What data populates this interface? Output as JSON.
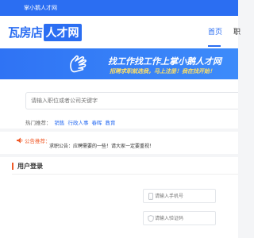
{
  "topbar": {
    "welcome": "掌小鹅人才网"
  },
  "header": {
    "logo_main": "瓦房店",
    "logo_box": "人才网",
    "nav": [
      {
        "label": "首页",
        "active": true
      },
      {
        "label": "职"
      }
    ]
  },
  "banner": {
    "headline": "找工作找工作上掌小鹅人才网",
    "subline": "招聘求职就选我，马上注册！我在找开始！"
  },
  "search": {
    "placeholder": "请输入职位或者公司关键字",
    "hot_label": "热门推荐：",
    "hot_links": [
      "销售",
      "行政人事",
      "春晖",
      "教育"
    ]
  },
  "notice": {
    "title": "公告推荐：",
    "text": "求职公告：应聘需要的一些！请大家一定要重视！"
  },
  "login": {
    "title": "用户登录",
    "phone_placeholder": "请输入手机号",
    "code_placeholder": "请输入验证码"
  },
  "colors": {
    "brand": "#2b6ef2",
    "accent": "#f05a28",
    "highlight": "#ffe066"
  }
}
